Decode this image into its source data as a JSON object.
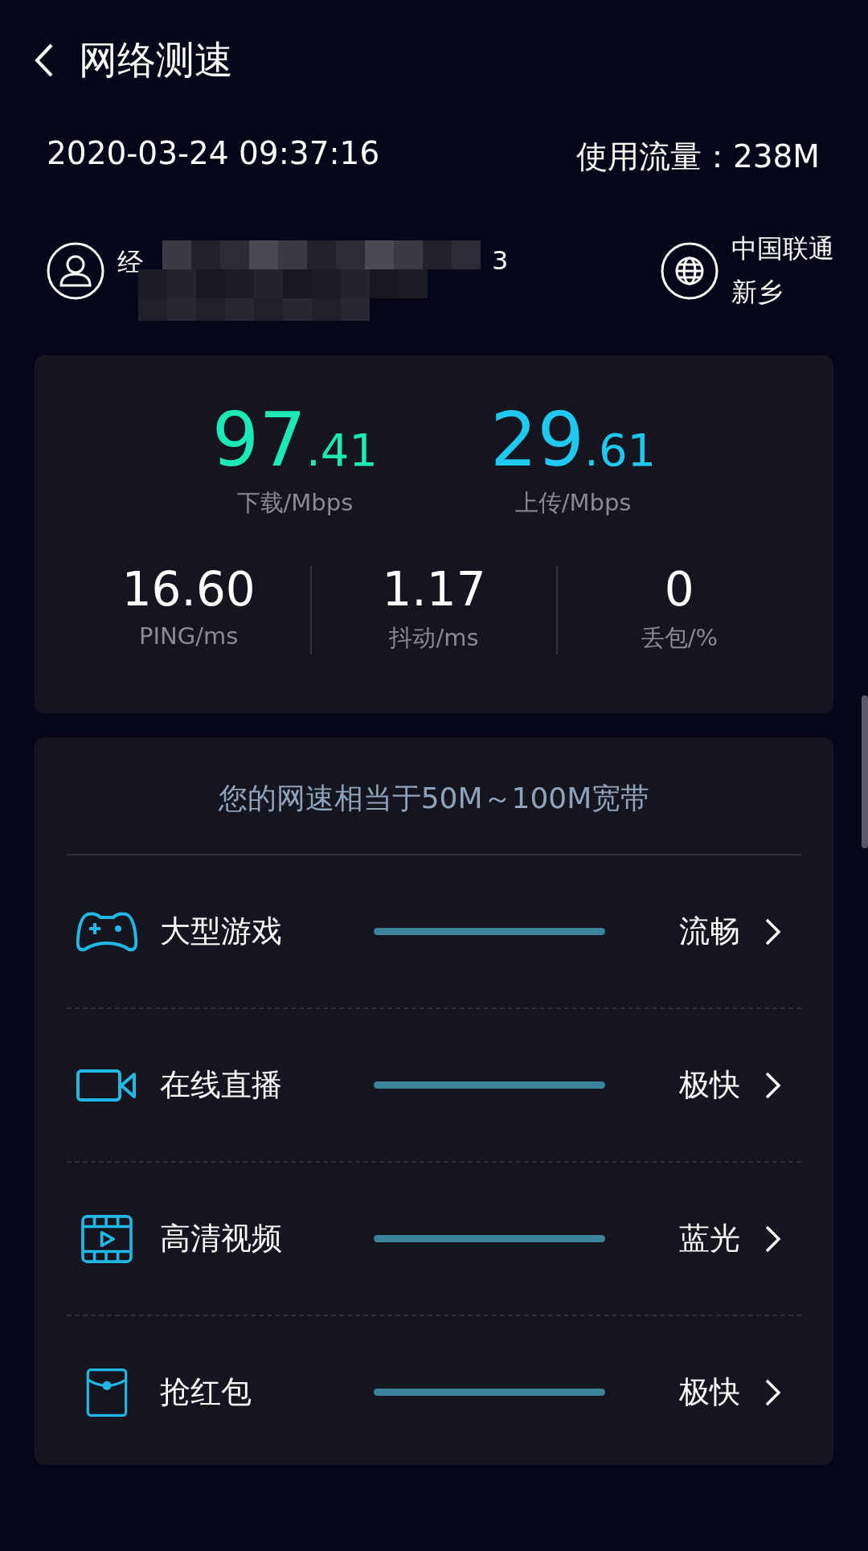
{
  "header": {
    "title": "网络测速"
  },
  "info": {
    "time": "2020-03-24 09:37:16",
    "usage_label": "使用流量：",
    "usage_value": "238M"
  },
  "account": {
    "name_start": "经",
    "name_end": "3"
  },
  "carrier": {
    "name": "中国联通",
    "city": "新乡"
  },
  "speeds": [
    {
      "whole": "97",
      "fraction": ".41",
      "unit": "下载/Mbps",
      "color": "#1de9b6"
    },
    {
      "whole": "29",
      "fraction": ".61",
      "unit": "上传/Mbps",
      "color": "#1ec8ef"
    }
  ],
  "stats": [
    {
      "value": "16.60",
      "unit": "PING/ms"
    },
    {
      "value": "1.17",
      "unit": "抖动/ms"
    },
    {
      "value": "0",
      "unit": "丢包/%"
    }
  ],
  "summary": "您的网速相当于50M～100M宽带",
  "uses": [
    {
      "kind": "game",
      "label": "大型游戏",
      "rating": "流畅"
    },
    {
      "kind": "live",
      "label": "在线直播",
      "rating": "极快"
    },
    {
      "kind": "video",
      "label": "高清视频",
      "rating": "蓝光"
    },
    {
      "kind": "redpacket",
      "label": "抢红包",
      "rating": "极快"
    }
  ]
}
